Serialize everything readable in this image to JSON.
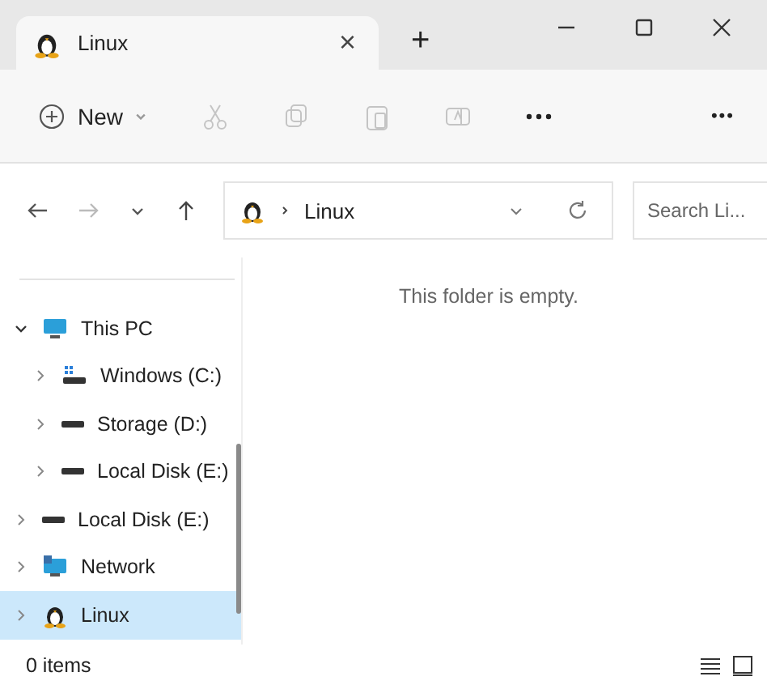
{
  "tab": {
    "title": "Linux",
    "close": "×"
  },
  "new_tab": "+",
  "toolbar": {
    "new_label": "New",
    "actions": [
      {
        "kind": "cut",
        "disabled": true
      },
      {
        "kind": "copy",
        "disabled": true
      },
      {
        "kind": "paste",
        "disabled": true
      },
      {
        "kind": "rename",
        "disabled": true
      },
      {
        "kind": "more",
        "disabled": false
      }
    ],
    "overflow": "•••"
  },
  "address": {
    "crumb": "Linux"
  },
  "search": {
    "placeholder": "Search Li..."
  },
  "tree": [
    {
      "label": "This PC",
      "kind": "pc",
      "expanded": true,
      "selected": false,
      "children": [
        {
          "label": "Windows (C:)",
          "kind": "windrive",
          "expanded": false,
          "selected": false
        },
        {
          "label": "Storage (D:)",
          "kind": "drive",
          "expanded": false,
          "selected": false
        },
        {
          "label": "Local Disk (E:)",
          "kind": "drive",
          "expanded": false,
          "selected": false
        }
      ]
    },
    {
      "label": "Local Disk (E:)",
      "kind": "drive",
      "expanded": false,
      "selected": false
    },
    {
      "label": "Network",
      "kind": "network",
      "expanded": false,
      "selected": false
    },
    {
      "label": "Linux",
      "kind": "linux",
      "expanded": false,
      "selected": true
    }
  ],
  "empty_message": "This folder is empty.",
  "status": {
    "count": "0 items"
  }
}
